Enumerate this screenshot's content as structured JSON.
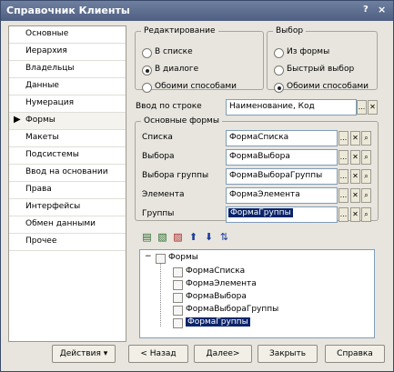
{
  "window": {
    "title": "Справочник Клиенты",
    "help_glyph": "?",
    "close_glyph": "×"
  },
  "sidebar": {
    "items": [
      {
        "label": "Основные"
      },
      {
        "label": "Иерархия"
      },
      {
        "label": "Владельцы"
      },
      {
        "label": "Данные"
      },
      {
        "label": "Нумерация"
      },
      {
        "label": "Формы",
        "active": true
      },
      {
        "label": "Макеты"
      },
      {
        "label": "Подсистемы"
      },
      {
        "label": "Ввод на основании"
      },
      {
        "label": "Права"
      },
      {
        "label": "Интерфейсы"
      },
      {
        "label": "Обмен данными"
      },
      {
        "label": "Прочее"
      }
    ],
    "active_arrow": "▶"
  },
  "editing": {
    "legend": "Редактирование",
    "options": [
      {
        "label": "В списке",
        "checked": false
      },
      {
        "label": "В диалоге",
        "checked": true
      },
      {
        "label": "Обоими способами",
        "checked": false
      }
    ]
  },
  "choice": {
    "legend": "Выбор",
    "options": [
      {
        "label": "Из формы",
        "checked": false
      },
      {
        "label": "Быстрый выбор",
        "checked": false
      },
      {
        "label": "Обоими способами",
        "checked": true
      }
    ]
  },
  "input_by_line": {
    "label": "Ввод по строке",
    "value": "Наименование, Код"
  },
  "main_forms": {
    "legend": "Основные формы",
    "rows": [
      {
        "label": "Списка",
        "value": "ФормаСписка"
      },
      {
        "label": "Выбора",
        "value": "ФормаВыбора"
      },
      {
        "label": "Выбора группы",
        "value": "ФормаВыбораГруппы"
      },
      {
        "label": "Элемента",
        "value": "ФормаЭлемента"
      },
      {
        "label": "Группы",
        "value": "ФормаГруппы",
        "selected": true
      }
    ]
  },
  "small_buttons": {
    "dots": "...",
    "clear": "✕",
    "search": "🔍"
  },
  "tree": {
    "root": "Формы",
    "expander": "−",
    "items": [
      {
        "label": "ФормаСписка"
      },
      {
        "label": "ФормаЭлемента"
      },
      {
        "label": "ФормаВыбора"
      },
      {
        "label": "ФормаВыбораГруппы"
      },
      {
        "label": "ФормаГруппы",
        "selected": true
      }
    ]
  },
  "buttons": {
    "actions": "Действия",
    "back": "< Назад",
    "next": "Далее>",
    "close": "Закрыть",
    "help": "Справка"
  }
}
